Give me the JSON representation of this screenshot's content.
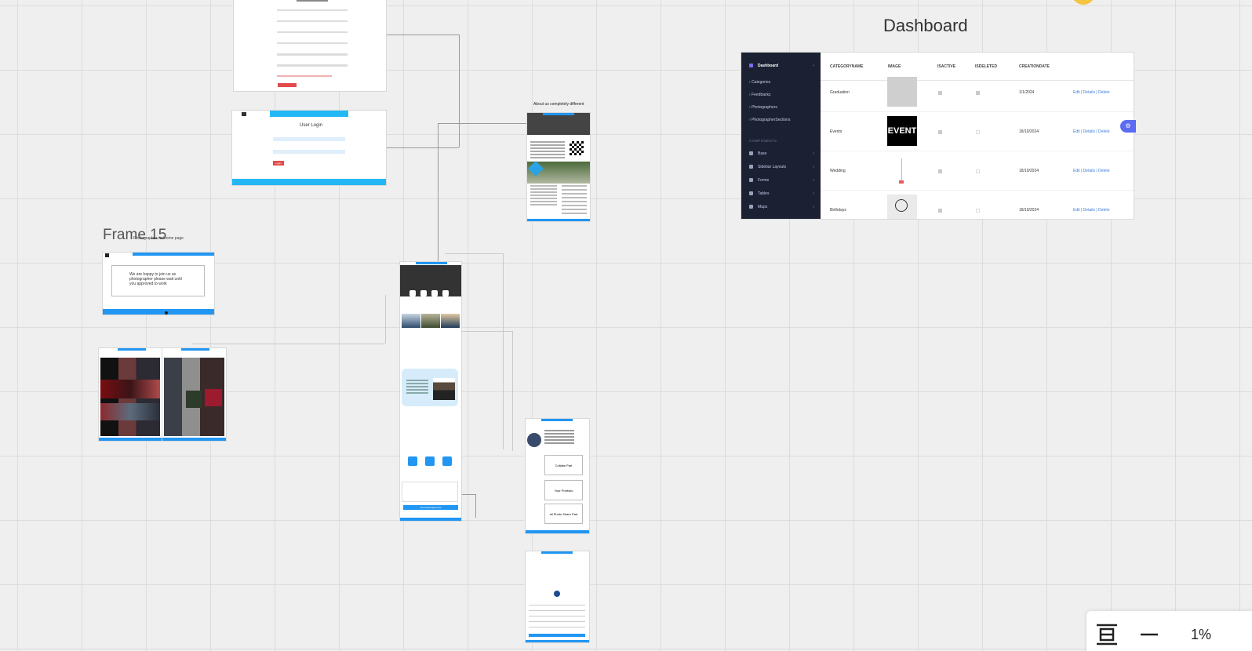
{
  "canvas": {
    "frame15_title": "Frame 15",
    "frame15_subtitle": "Photographer welcome page",
    "about_caption": "About us completely different",
    "dashboard_title": "Dashboard"
  },
  "login_frame": {
    "heading": "User Login",
    "login_button": "Login"
  },
  "frame15": {
    "message": "We are happy to join us as photographer please wait until you approved to work"
  },
  "dashboard": {
    "sidebar": {
      "active_item": "Dashboard",
      "items": [
        "Categories",
        "Feedbacks",
        "Photographers",
        "PhotographerSections"
      ],
      "components_heading": "COMPONENTS",
      "component_items": [
        "Base",
        "Sidebar Layouts",
        "Forms",
        "Tables",
        "Maps"
      ]
    },
    "columns": [
      "CATEGORYNAME",
      "IMAGE",
      "ISACTIVE",
      "ISDELETED",
      "CREATIONDATE"
    ],
    "rows": [
      {
        "name": "Graduation",
        "date": "1/1/2024",
        "actions": "Edit | Details | Delete"
      },
      {
        "name": "Events",
        "date": "18/10/2024",
        "image_text": "EVENT",
        "actions": "Edit | Details | Delete"
      },
      {
        "name": "Wedding",
        "date": "18/10/2024",
        "actions": "Edit | Details | Delete"
      },
      {
        "name": "Birthdays",
        "date": "18/10/2024",
        "actions": "Edit | Details | Delete"
      }
    ]
  },
  "contact_frame": {
    "send_button": "Send Message Now"
  },
  "profile_frame": {
    "boxes": [
      "Collabs Part",
      "Your Portfolio",
      "all Photo Share Part"
    ]
  },
  "toolbar": {
    "zoom": "1%",
    "icons": [
      "fit-frame-icon",
      "zoom-out-icon"
    ]
  }
}
